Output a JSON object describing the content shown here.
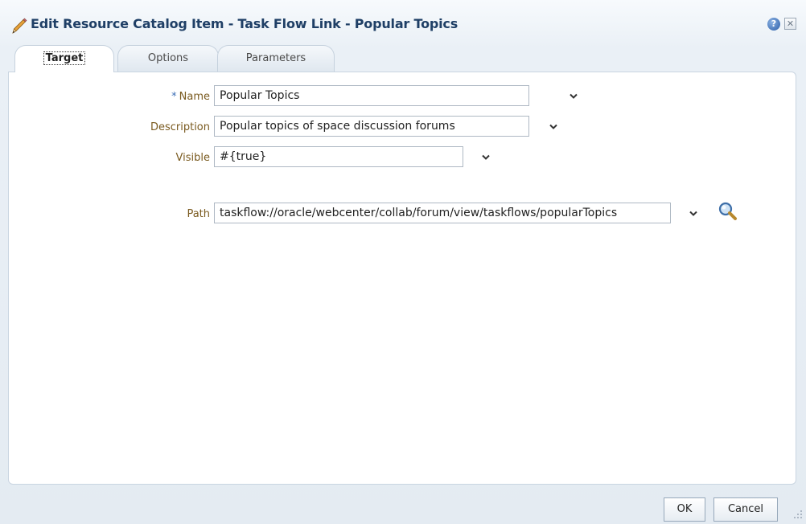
{
  "dialog": {
    "title": "Edit Resource Catalog Item - Task Flow Link - Popular Topics",
    "help_icon": "help-icon",
    "help_glyph": "?",
    "close_icon": "close-icon",
    "close_glyph": "✕"
  },
  "tabs": [
    {
      "label": "Target",
      "selected": true
    },
    {
      "label": "Options",
      "selected": false
    },
    {
      "label": "Parameters",
      "selected": false
    }
  ],
  "form": {
    "name": {
      "label": "Name",
      "required_marker": "*",
      "value": "Popular Topics"
    },
    "description": {
      "label": "Description",
      "value": "Popular topics of space discussion forums"
    },
    "visible": {
      "label": "Visible",
      "value": "#{true}"
    },
    "path": {
      "label": "Path",
      "value": "taskflow://oracle/webcenter/collab/forum/view/taskflows/popularTopics"
    }
  },
  "footer": {
    "ok_label": "OK",
    "cancel_label": "Cancel"
  },
  "colors": {
    "title": "#1f3f66",
    "label": "#7a5a1f",
    "required": "#3d6fb6"
  }
}
